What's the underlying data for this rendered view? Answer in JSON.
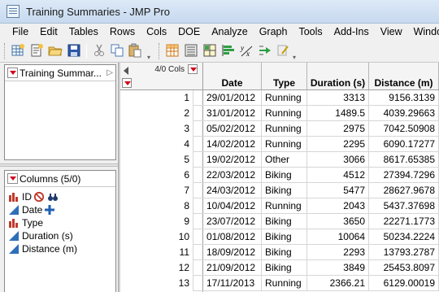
{
  "window": {
    "title": "Training Summaries - JMP Pro"
  },
  "menu": [
    "File",
    "Edit",
    "Tables",
    "Rows",
    "Cols",
    "DOE",
    "Analyze",
    "Graph",
    "Tools",
    "Add-Ins",
    "View",
    "Window"
  ],
  "toolbar": {
    "buttons": [
      "new-table-icon",
      "new-script-icon",
      "open-icon",
      "save-icon",
      "cut-icon",
      "copy-icon",
      "paste-icon",
      "data-grid-icon",
      "data-table-list-icon",
      "tabulate-icon",
      "distribution-icon",
      "fit-y-by-x-icon",
      "fit-model-icon",
      "edit-script-icon"
    ]
  },
  "table_panel": {
    "title": "Training Summar..."
  },
  "columns_panel": {
    "title": "Columns (5/0)",
    "items": [
      {
        "label": "ID",
        "type_icon": "nominal-icon",
        "extra_icons": [
          "no-symbol-icon",
          "binoculars-icon"
        ]
      },
      {
        "label": "Date",
        "type_icon": "continuous-icon",
        "extra_icons": [
          "add-icon"
        ]
      },
      {
        "label": "Type",
        "type_icon": "nominal-icon",
        "extra_icons": []
      },
      {
        "label": "Duration (s)",
        "type_icon": "continuous-icon",
        "extra_icons": []
      },
      {
        "label": "Distance (m)",
        "type_icon": "continuous-icon",
        "extra_icons": []
      }
    ]
  },
  "grid": {
    "cols_indicator": "4/0 Cols",
    "headers": [
      "Date",
      "Type",
      "Duration (s)",
      "Distance (m)"
    ],
    "rows": [
      {
        "n": "1",
        "date": "29/01/2012",
        "type": "Running",
        "duration": "3313",
        "distance": "9156.3139"
      },
      {
        "n": "2",
        "date": "31/01/2012",
        "type": "Running",
        "duration": "1489.5",
        "distance": "4039.29663"
      },
      {
        "n": "3",
        "date": "05/02/2012",
        "type": "Running",
        "duration": "2975",
        "distance": "7042.50908"
      },
      {
        "n": "4",
        "date": "14/02/2012",
        "type": "Running",
        "duration": "2295",
        "distance": "6090.17277"
      },
      {
        "n": "5",
        "date": "19/02/2012",
        "type": "Other",
        "duration": "3066",
        "distance": "8617.65385"
      },
      {
        "n": "6",
        "date": "22/03/2012",
        "type": "Biking",
        "duration": "4512",
        "distance": "27394.7296"
      },
      {
        "n": "7",
        "date": "24/03/2012",
        "type": "Biking",
        "duration": "5477",
        "distance": "28627.9678"
      },
      {
        "n": "8",
        "date": "10/04/2012",
        "type": "Running",
        "duration": "2043",
        "distance": "5437.37698"
      },
      {
        "n": "9",
        "date": "23/07/2012",
        "type": "Biking",
        "duration": "3650",
        "distance": "22271.1773"
      },
      {
        "n": "10",
        "date": "01/08/2012",
        "type": "Biking",
        "duration": "10064",
        "distance": "50234.2224"
      },
      {
        "n": "11",
        "date": "18/09/2012",
        "type": "Biking",
        "duration": "2293",
        "distance": "13793.2787"
      },
      {
        "n": "12",
        "date": "21/09/2012",
        "type": "Biking",
        "duration": "3849",
        "distance": "25453.8097"
      },
      {
        "n": "13",
        "date": "17/11/2013",
        "type": "Running",
        "duration": "2366.21",
        "distance": "6129.00019"
      }
    ]
  },
  "colors": {
    "accent_red": "#d0021b",
    "continuous_blue": "#2f6fb8",
    "nominal_red": "#c0392b"
  }
}
